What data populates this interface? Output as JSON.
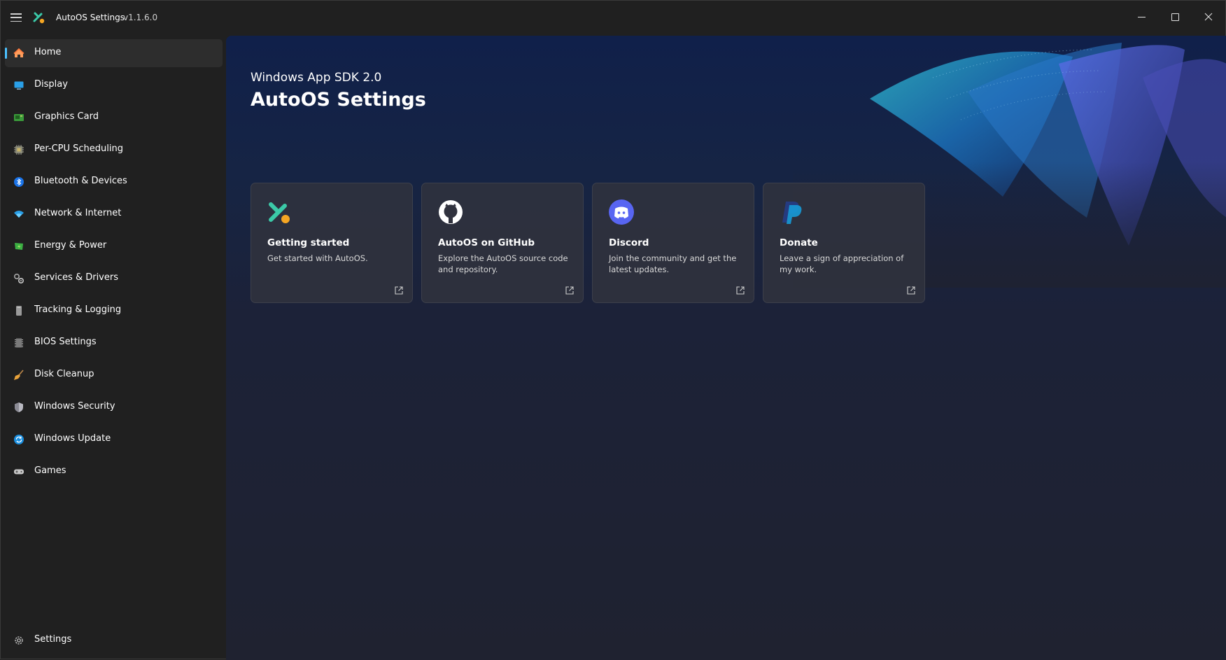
{
  "window": {
    "title": "AutoOS Settings",
    "version": "v1.1.6.0"
  },
  "sidebar": {
    "items": [
      {
        "label": "Home",
        "icon": "home-icon",
        "active": true
      },
      {
        "label": "Display",
        "icon": "display-icon"
      },
      {
        "label": "Graphics Card",
        "icon": "graphics-card-icon"
      },
      {
        "label": "Per-CPU Scheduling",
        "icon": "cpu-icon"
      },
      {
        "label": "Bluetooth & Devices",
        "icon": "bluetooth-icon"
      },
      {
        "label": "Network & Internet",
        "icon": "wifi-icon"
      },
      {
        "label": "Energy & Power",
        "icon": "battery-icon"
      },
      {
        "label": "Services & Drivers",
        "icon": "gears-icon"
      },
      {
        "label": "Tracking & Logging",
        "icon": "log-icon"
      },
      {
        "label": "BIOS Settings",
        "icon": "chip-icon"
      },
      {
        "label": "Disk Cleanup",
        "icon": "broom-icon"
      },
      {
        "label": "Windows Security",
        "icon": "shield-icon"
      },
      {
        "label": "Windows Update",
        "icon": "update-icon"
      },
      {
        "label": "Games",
        "icon": "gamepad-icon"
      }
    ],
    "footer": {
      "label": "Settings",
      "icon": "gear-icon"
    }
  },
  "hero": {
    "subtitle": "Windows App SDK 2.0",
    "title": "AutoOS Settings"
  },
  "cards": [
    {
      "title": "Getting started",
      "description": "Get started with AutoOS.",
      "icon": "tools-icon"
    },
    {
      "title": "AutoOS on GitHub",
      "description": "Explore the AutoOS source code and repository.",
      "icon": "github-icon"
    },
    {
      "title": "Discord",
      "description": "Join the community and get the latest updates.",
      "icon": "discord-icon"
    },
    {
      "title": "Donate",
      "description": "Leave a sign of appreciation of my work.",
      "icon": "paypal-icon"
    }
  ],
  "colors": {
    "accent": "#4cc2ff",
    "discord": "#5865f2",
    "paypal_dark": "#253b80",
    "paypal_light": "#179bd7"
  }
}
